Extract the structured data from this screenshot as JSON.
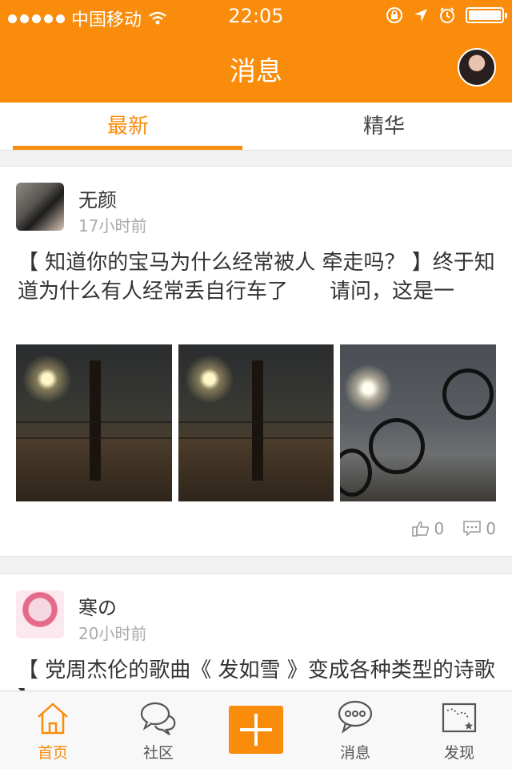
{
  "status_bar": {
    "carrier": "中国移动",
    "time": "22:05"
  },
  "header": {
    "title": "消息"
  },
  "tabs": [
    {
      "label": "最新",
      "active": true
    },
    {
      "label": "精华",
      "active": false
    }
  ],
  "posts": [
    {
      "author": "无颜",
      "time": "17小时前",
      "text": "【 知道你的宝马为什么经常被人 牵走吗？ 】终于知道为什么有人经常丢自行车了　　请问，这是一",
      "likes": "0",
      "comments": "0"
    },
    {
      "author": "寒の",
      "time": "20小时前",
      "text": "【 党周杰伦的歌曲《 发如雪 》变成各种类型的诗歌 】"
    }
  ],
  "tabbar": {
    "items": [
      {
        "label": "首页",
        "icon": "home-icon",
        "active": true
      },
      {
        "label": "社区",
        "icon": "chat-bubbles-icon",
        "active": false
      },
      {
        "label": "",
        "icon": "plus-icon",
        "active": false
      },
      {
        "label": "消息",
        "icon": "message-icon",
        "active": false
      },
      {
        "label": "发现",
        "icon": "map-icon",
        "active": false
      }
    ]
  },
  "colors": {
    "accent": "#f98c0b"
  }
}
